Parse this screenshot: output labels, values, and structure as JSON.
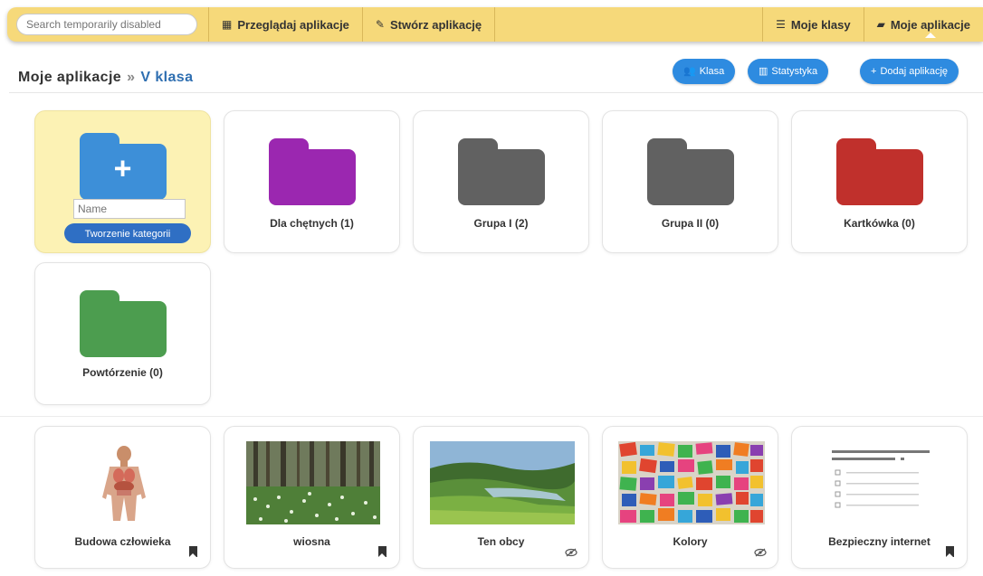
{
  "nav": {
    "search_placeholder": "Search temporarily disabled",
    "browse": "Przeglądaj aplikacje",
    "create": "Stwórz aplikację",
    "my_classes": "Moje klasy",
    "my_apps": "Moje aplikacje"
  },
  "header": {
    "root": "Moje aplikacje",
    "separator": "»",
    "current": "V klasa",
    "btn_class": "Klasa",
    "btn_stats": "Statystyka",
    "btn_add": "Dodaj aplikację"
  },
  "create_card": {
    "name_placeholder": "Name",
    "button": "Tworzenie kategorii"
  },
  "folders": [
    {
      "label": "Dla chętnych (1)",
      "color": "#9b27b0"
    },
    {
      "label": "Grupa I (2)",
      "color": "#616161"
    },
    {
      "label": "Grupa II (0)",
      "color": "#616161"
    },
    {
      "label": "Kartkówka (0)",
      "color": "#c0302c"
    },
    {
      "label": "Powtórzenie (0)",
      "color": "#4c9d4f"
    }
  ],
  "apps": [
    {
      "label": "Budowa człowieka",
      "icon": "bookmark-icon"
    },
    {
      "label": "wiosna",
      "icon": "bookmark-icon"
    },
    {
      "label": "Ten obcy",
      "icon": "eye-slash-icon"
    },
    {
      "label": "Kolory",
      "icon": "eye-slash-icon"
    },
    {
      "label": "Bezpieczny internet",
      "icon": "bookmark-icon"
    }
  ],
  "colors": {
    "nav_bg": "#f6d97a",
    "accent": "#2e8be0",
    "create_card_bg": "#fcf2b4",
    "folder_plus": "#3d8fd8"
  }
}
